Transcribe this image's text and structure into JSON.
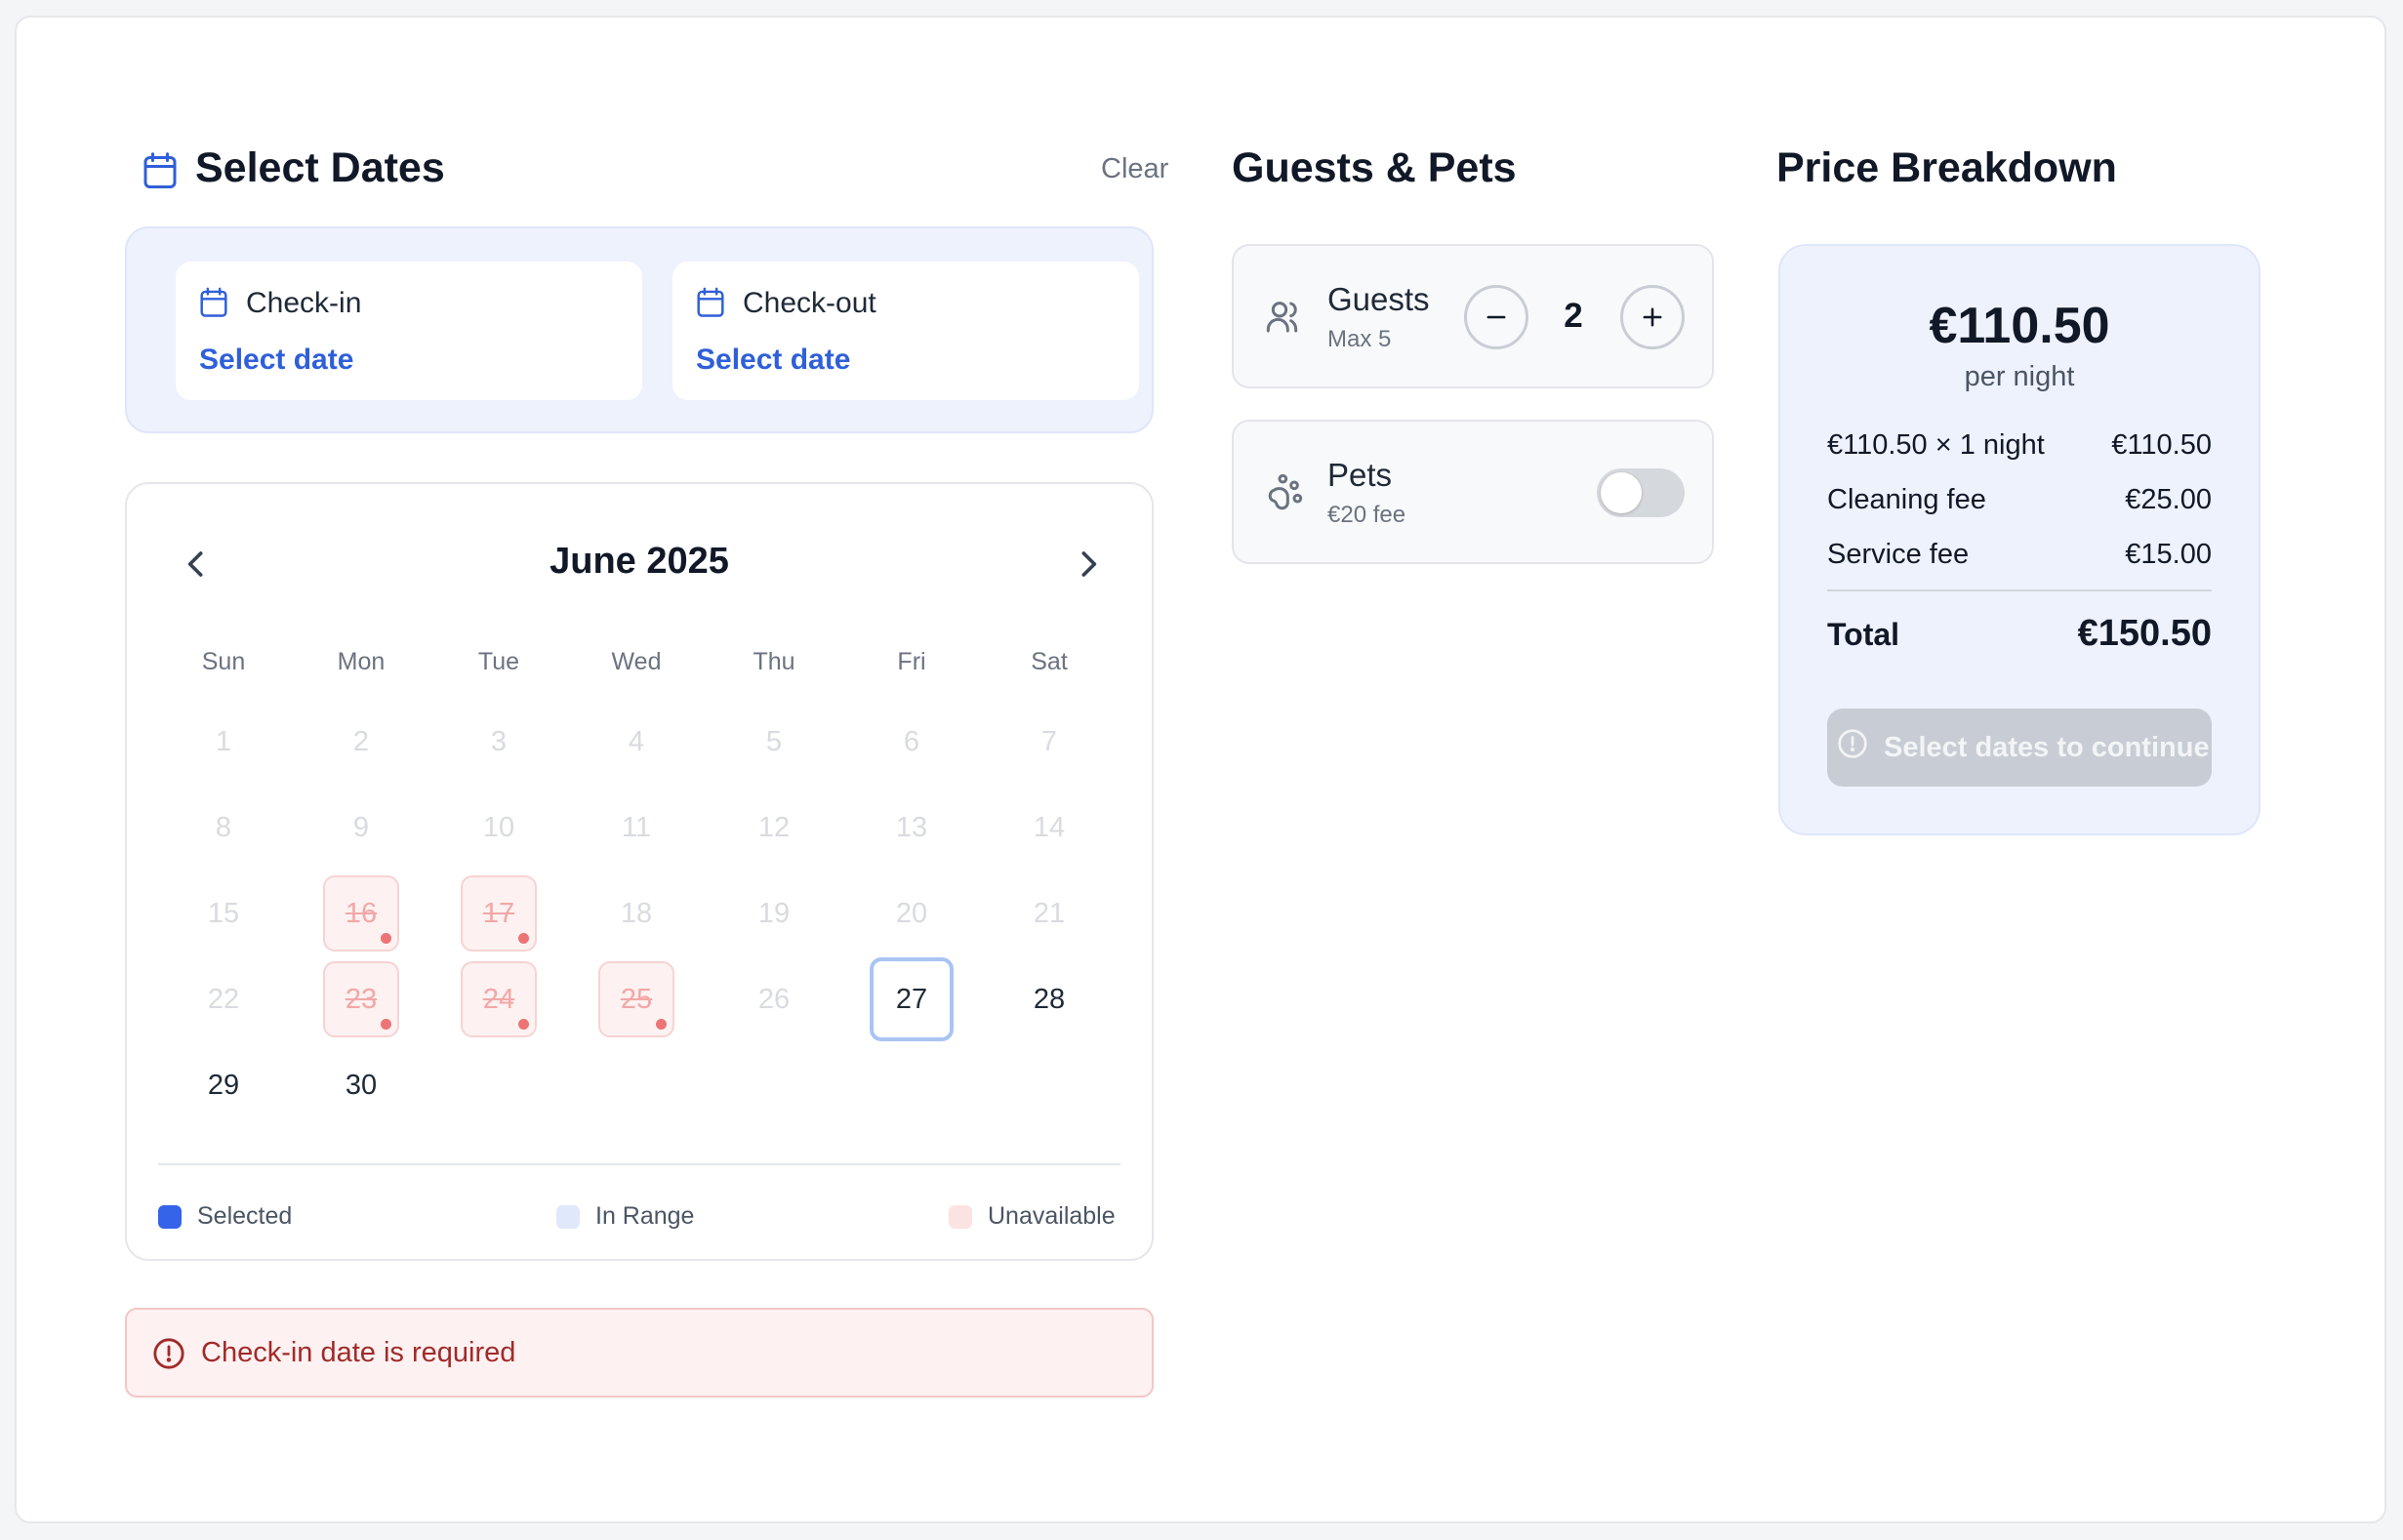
{
  "select_dates": {
    "title": "Select Dates",
    "clear_label": "Clear",
    "check_in": {
      "label": "Check-in",
      "value": "Select date"
    },
    "check_out": {
      "label": "Check-out",
      "value": "Select date"
    }
  },
  "calendar": {
    "month": "June 2025",
    "weekdays": [
      "Sun",
      "Mon",
      "Tue",
      "Wed",
      "Thu",
      "Fri",
      "Sat"
    ],
    "days": [
      {
        "n": "1",
        "state": "past"
      },
      {
        "n": "2",
        "state": "past"
      },
      {
        "n": "3",
        "state": "past"
      },
      {
        "n": "4",
        "state": "past"
      },
      {
        "n": "5",
        "state": "past"
      },
      {
        "n": "6",
        "state": "past"
      },
      {
        "n": "7",
        "state": "past"
      },
      {
        "n": "8",
        "state": "past"
      },
      {
        "n": "9",
        "state": "past"
      },
      {
        "n": "10",
        "state": "past"
      },
      {
        "n": "11",
        "state": "past"
      },
      {
        "n": "12",
        "state": "past"
      },
      {
        "n": "13",
        "state": "past"
      },
      {
        "n": "14",
        "state": "past"
      },
      {
        "n": "15",
        "state": "past"
      },
      {
        "n": "16",
        "state": "unavail"
      },
      {
        "n": "17",
        "state": "unavail"
      },
      {
        "n": "18",
        "state": "past"
      },
      {
        "n": "19",
        "state": "past"
      },
      {
        "n": "20",
        "state": "past"
      },
      {
        "n": "21",
        "state": "past"
      },
      {
        "n": "22",
        "state": "past"
      },
      {
        "n": "23",
        "state": "unavail"
      },
      {
        "n": "24",
        "state": "unavail"
      },
      {
        "n": "25",
        "state": "unavail"
      },
      {
        "n": "26",
        "state": "past"
      },
      {
        "n": "27",
        "state": "today"
      },
      {
        "n": "28",
        "state": "avail"
      },
      {
        "n": "29",
        "state": "avail"
      },
      {
        "n": "30",
        "state": "avail"
      }
    ],
    "legend": {
      "selected": "Selected",
      "in_range": "In Range",
      "unavailable": "Unavailable"
    }
  },
  "error": {
    "message": "Check-in date is required"
  },
  "guests_pets": {
    "title": "Guests & Pets",
    "guests": {
      "label": "Guests",
      "sub": "Max 5",
      "count": "2"
    },
    "pets": {
      "label": "Pets",
      "sub": "€20 fee",
      "enabled": false
    }
  },
  "price": {
    "title": "Price Breakdown",
    "nightly": "€110.50",
    "per_night": "per night",
    "lines": [
      {
        "label": "€110.50 × 1 night",
        "value": "€110.50"
      },
      {
        "label": "Cleaning fee",
        "value": "€25.00"
      },
      {
        "label": "Service fee",
        "value": "€15.00"
      }
    ],
    "total_label": "Total",
    "total_value": "€150.50",
    "cta_label": "Select dates to continue"
  },
  "colors": {
    "accent": "#2f5fd9",
    "selected": "#3563e9",
    "in_range": "#dfe9fb",
    "unavailable": "#fce3e3",
    "error_text": "#a12a2a"
  }
}
